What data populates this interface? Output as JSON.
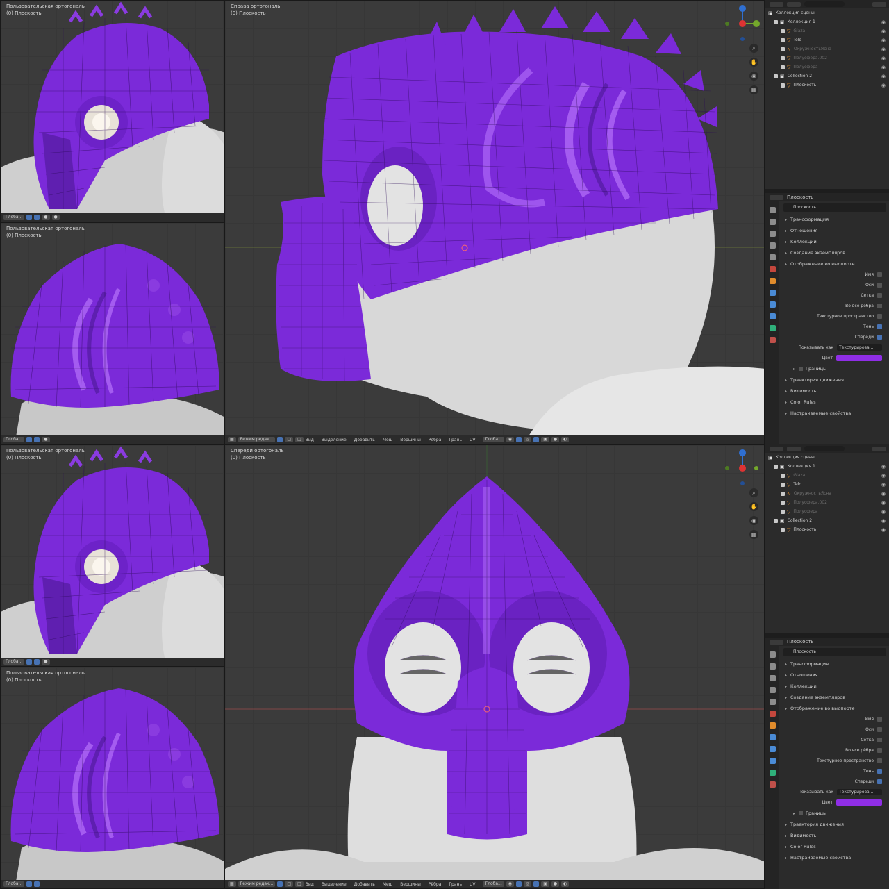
{
  "accent": "#8a2be2",
  "mesh_color": "#7b2ad9",
  "views": {
    "left_top": {
      "line1": "Пользовательская ортогональ",
      "line2": "(0) Плоскость"
    },
    "left_bottom": {
      "line1": "Пользовательская ортогональ",
      "line2": "(0) Плоскость"
    },
    "main_top": {
      "line1": "Справа ортогональ",
      "line2": "(0) Плоскость"
    },
    "main_bottom": {
      "line1": "Спереди ортогональ",
      "line2": "(0) Плоскость"
    }
  },
  "header_menu": {
    "mode": "Режим редак...",
    "items": [
      "Вид",
      "Выделение",
      "Добавить",
      "Меш",
      "Вершины",
      "Рёбра",
      "Грань",
      "UV"
    ],
    "transform": "Глоба..."
  },
  "outliner": {
    "items": [
      {
        "label": "Коллекция сцены",
        "icon": "scene-collection-icon",
        "dim": false
      },
      {
        "label": "Коллекция 1",
        "icon": "collection-icon",
        "dim": false
      },
      {
        "label": "Glaza",
        "icon": "mesh-icon",
        "dim": true
      },
      {
        "label": "Telo",
        "icon": "mesh-icon",
        "dim": false
      },
      {
        "label": "ОкружностьЯсна",
        "icon": "curve-icon",
        "dim": true
      },
      {
        "label": "Полусфера.002",
        "icon": "mesh-icon",
        "dim": true
      },
      {
        "label": "Полусфера",
        "icon": "mesh-icon",
        "dim": true
      },
      {
        "label": "Collection 2",
        "icon": "collection-icon",
        "dim": false
      },
      {
        "label": "Плоскость",
        "icon": "mesh-icon",
        "dim": false
      }
    ]
  },
  "properties": {
    "header": "Плоскость",
    "object_name": "Плоскость",
    "sections": [
      "Трансформация",
      "Отношения",
      "Коллекции",
      "Создание экземпляров",
      "Отображение во вьюпорте"
    ],
    "viewport_display": [
      {
        "label": "Имя",
        "checked": false
      },
      {
        "label": "Оси",
        "checked": false
      },
      {
        "label": "Сетка",
        "checked": false
      },
      {
        "label": "Во все рёбра",
        "checked": false
      },
      {
        "label": "Текстурное пространство",
        "checked": false
      },
      {
        "label": "Тень",
        "checked": true
      },
      {
        "label": "Спереди",
        "checked": true
      }
    ],
    "display_as_label": "Показывать как",
    "display_as_value": "Текстурирова...",
    "color_label": "Цвет",
    "color_value": "#8f2ee6",
    "bounds_label": "Границы",
    "sections_after": [
      "Траектория движения",
      "Видимость",
      "Color Rules",
      "Настраиваемые свойства"
    ]
  }
}
